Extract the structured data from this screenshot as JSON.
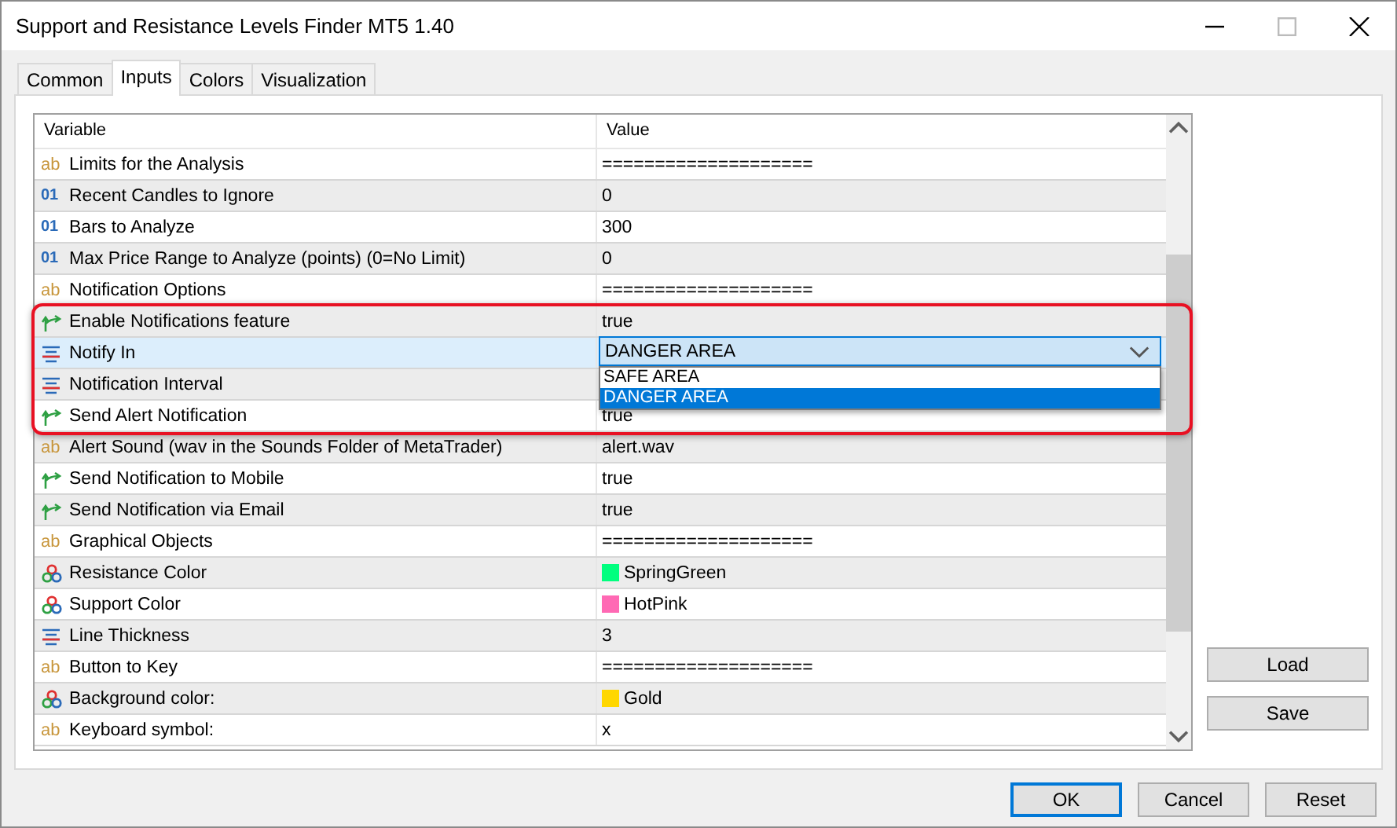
{
  "window": {
    "title": "Support and Resistance Levels Finder MT5 1.40"
  },
  "tabs": [
    {
      "label": "Common",
      "selected": false
    },
    {
      "label": "Inputs",
      "selected": true
    },
    {
      "label": "Colors",
      "selected": false
    },
    {
      "label": "Visualization",
      "selected": false
    }
  ],
  "table": {
    "columns": [
      "Variable",
      "Value"
    ],
    "rows": [
      {
        "kind": "text",
        "badge": "ab",
        "variable": "Limits for the Analysis",
        "value": "====================",
        "selected": false
      },
      {
        "kind": "number",
        "badge": "01",
        "variable": "Recent Candles to Ignore",
        "value": "0",
        "selected": false
      },
      {
        "kind": "number",
        "badge": "01",
        "variable": "Bars to Analyze",
        "value": "300",
        "selected": false
      },
      {
        "kind": "number",
        "badge": "01",
        "variable": "Max Price Range to Analyze (points) (0=No Limit)",
        "value": "0",
        "selected": false
      },
      {
        "kind": "text",
        "badge": "ab",
        "variable": "Notification Options",
        "value": "====================",
        "selected": false
      },
      {
        "kind": "bool",
        "variable": "Enable Notifications feature",
        "value": "true",
        "selected": false
      },
      {
        "kind": "enum",
        "variable": "Notify In",
        "selected": true
      },
      {
        "kind": "enum",
        "variable": "Notification Interval",
        "selected": false
      },
      {
        "kind": "bool",
        "variable": "Send Alert Notification",
        "value": "true",
        "selected": false
      },
      {
        "kind": "text",
        "badge": "ab",
        "variable": "Alert Sound (wav in the Sounds Folder of MetaTrader)",
        "value": "alert.wav",
        "selected": false
      },
      {
        "kind": "bool",
        "variable": "Send Notification to Mobile",
        "value": "true",
        "selected": false
      },
      {
        "kind": "bool",
        "variable": "Send Notification via Email",
        "value": "true",
        "selected": false
      },
      {
        "kind": "text",
        "badge": "ab",
        "variable": "Graphical Objects",
        "value": "====================",
        "selected": false
      },
      {
        "kind": "color",
        "variable": "Resistance Color",
        "value": "SpringGreen",
        "color": "#00ff7f",
        "selected": false
      },
      {
        "kind": "color",
        "variable": "Support Color",
        "value": "HotPink",
        "color": "#ff69b4",
        "selected": false
      },
      {
        "kind": "enum",
        "variable": "Line Thickness",
        "value": "3",
        "selected": false
      },
      {
        "kind": "text",
        "badge": "ab",
        "variable": "Button to Key",
        "value": "====================",
        "selected": false
      },
      {
        "kind": "color",
        "variable": "Background color:",
        "value": "Gold",
        "color": "#ffd700",
        "selected": false
      },
      {
        "kind": "text",
        "badge": "ab",
        "variable": "Keyboard symbol:",
        "value": "x",
        "selected": false
      }
    ]
  },
  "dropdown": {
    "value": "DANGER AREA",
    "options": [
      {
        "label": "SAFE AREA",
        "selected": false
      },
      {
        "label": "DANGER AREA",
        "selected": true
      }
    ]
  },
  "side_buttons": [
    "Load",
    "Save"
  ],
  "buttons": [
    {
      "label": "OK",
      "default": true
    },
    {
      "label": "Cancel",
      "default": false
    },
    {
      "label": "Reset",
      "default": false
    }
  ]
}
